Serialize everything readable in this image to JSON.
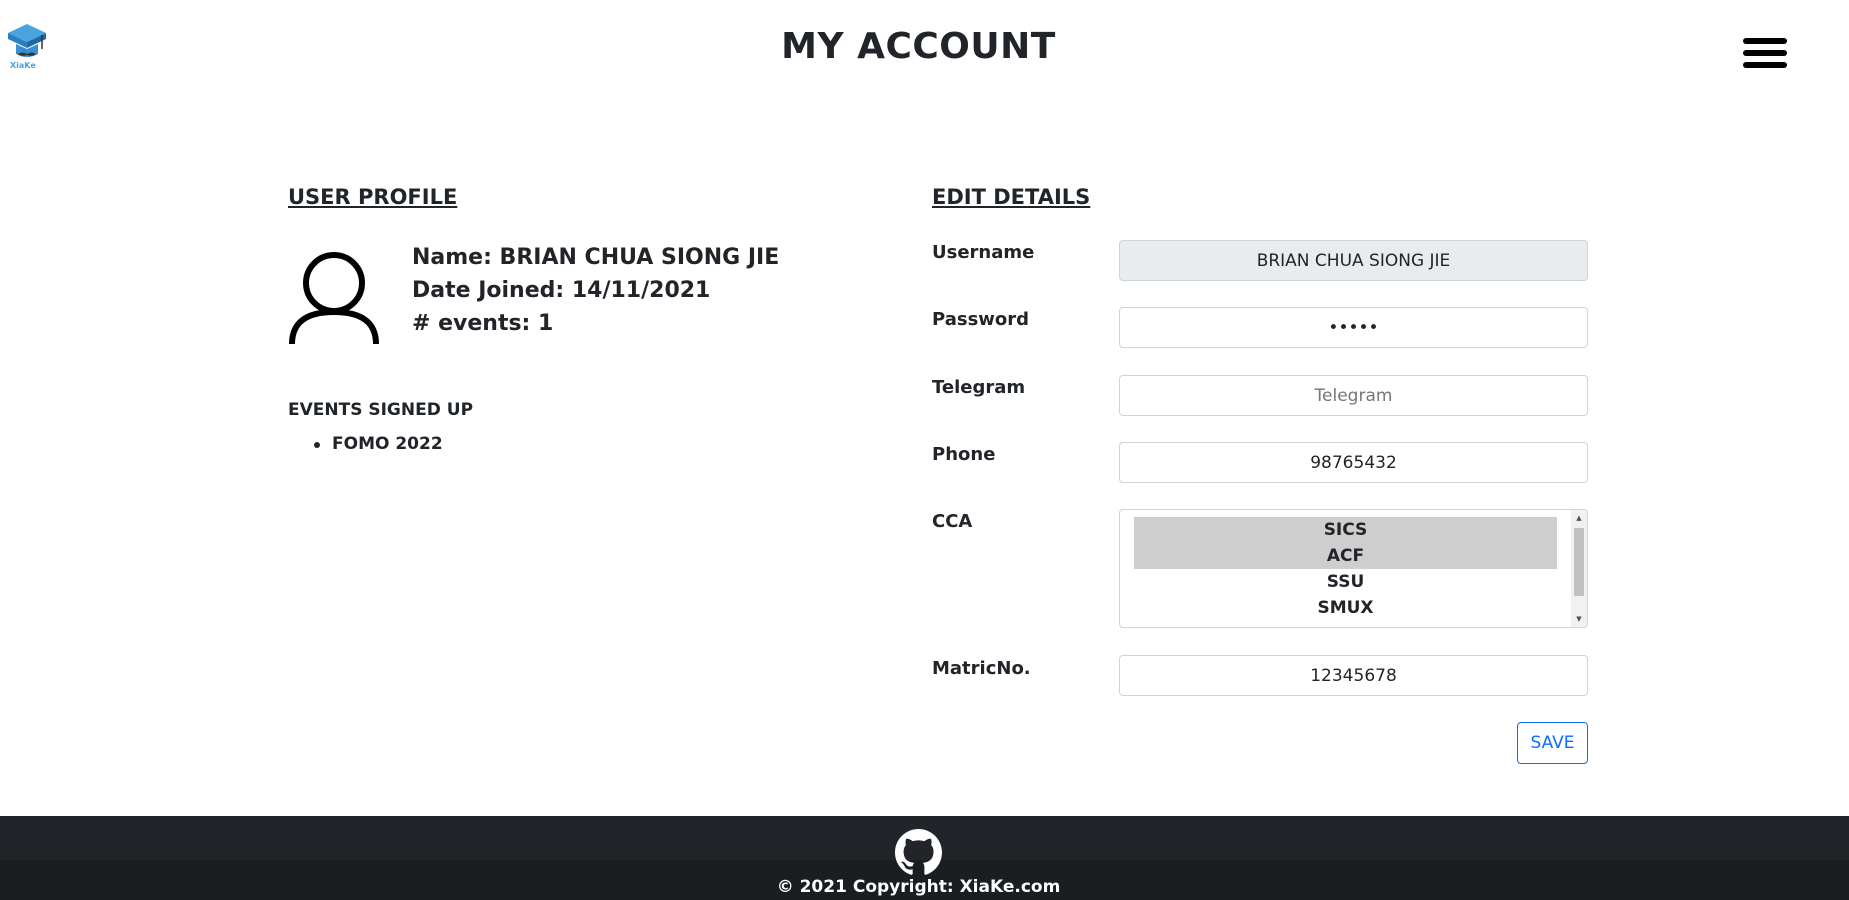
{
  "brand": {
    "name": "XiaKe",
    "logo_icon": "graduation-cap-logo-icon"
  },
  "header": {
    "title": "MY ACCOUNT",
    "menu_icon": "hamburger-menu-icon"
  },
  "profile": {
    "heading": "USER PROFILE",
    "avatar_icon": "user-avatar-icon",
    "name_line": "Name: BRIAN CHUA SIONG JIE",
    "date_joined_line": "Date Joined: 14/11/2021",
    "events_count_line": "# events: 1",
    "events_title": "EVENTS SIGNED UP",
    "events": [
      "FOMO 2022"
    ]
  },
  "edit": {
    "heading": "EDIT DETAILS",
    "username": {
      "label": "Username",
      "value": "BRIAN CHUA SIONG JIE"
    },
    "password": {
      "label": "Password",
      "value": "•••••"
    },
    "telegram": {
      "label": "Telegram",
      "placeholder": "Telegram"
    },
    "phone": {
      "label": "Phone",
      "value": "98765432"
    },
    "cca": {
      "label": "CCA",
      "options": [
        "SICS",
        "ACF",
        "SSU",
        "SMUX"
      ],
      "selected": [
        "SICS",
        "ACF"
      ]
    },
    "matric": {
      "label": "MatricNo.",
      "value": "12345678"
    },
    "save_label": "SAVE"
  },
  "footer": {
    "icon": "github-icon",
    "copyright": "© 2021 Copyright: XiaKe.com"
  },
  "colors": {
    "primary": "#0d6efd",
    "footer_bg": "#212529",
    "logo_blue": "#4aa3df"
  }
}
